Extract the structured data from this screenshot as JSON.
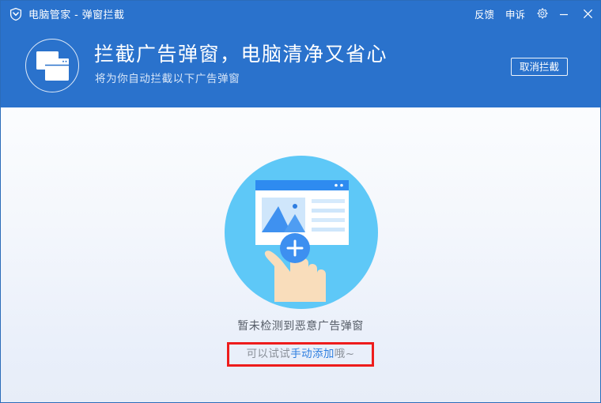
{
  "window": {
    "logo_icon": "shield-icon",
    "title": "电脑管家 - 弹窗拦截",
    "controls": {
      "feedback_label": "反馈",
      "appeal_label": "申诉",
      "settings_icon": "gear-icon",
      "minimize_icon": "minimize-icon",
      "close_icon": "close-icon"
    },
    "accent_color": "#2a72cc",
    "border_color": "#2b6cb9"
  },
  "banner": {
    "icon": "windows-stack-icon",
    "title": "拦截广告弹窗，电脑清净又省心",
    "subtitle": "将为你自动拦截以下广告弹窗",
    "action_label": "取消拦截"
  },
  "main": {
    "illustration": {
      "name": "add-popup-illustration",
      "circle_color": "#5ec8f7",
      "card_header_color": "#2e8bf0",
      "plus_button_color": "#3d8ff0",
      "plus_glyph": "+",
      "hand_color": "#f9ddbb"
    },
    "status_text": "暂未检测到恶意广告弹窗",
    "hint": {
      "prefix": "可以试试",
      "link": "手动添加",
      "suffix": "哦~",
      "highlight_color": "#ee1c1c",
      "link_color": "#2f7fe0"
    }
  }
}
